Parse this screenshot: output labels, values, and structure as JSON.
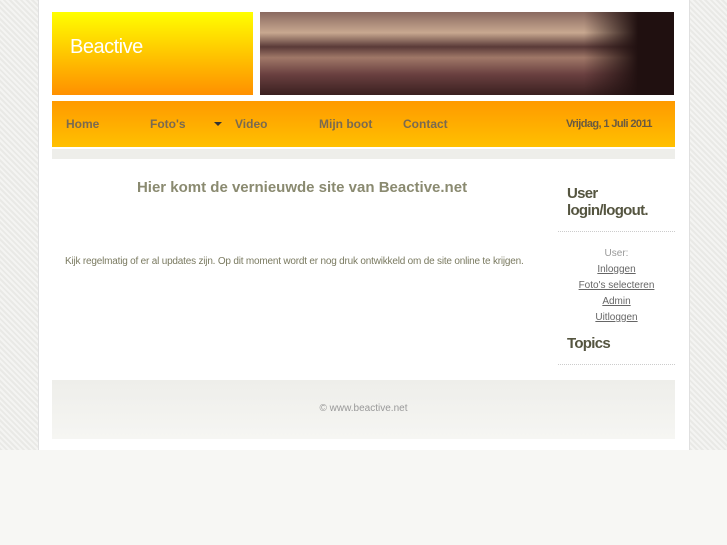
{
  "site": {
    "name": "Beactive"
  },
  "nav": {
    "items": [
      "Home",
      "Foto's",
      "Video",
      "Mijn boot",
      "Contact"
    ],
    "date": "Vrijdag, 1 Juli 2011"
  },
  "main": {
    "title": "Hier komt de vernieuwde site van Beactive.net",
    "text": "Kijk regelmatig of er al updates zijn. Op dit moment wordt er nog druk ontwikkeld om de site online te krijgen."
  },
  "sidebar": {
    "login_title": "User login/logout.",
    "user_label": "User:",
    "links": [
      "Inloggen",
      "Foto's selecteren",
      "Admin",
      "Uitloggen"
    ],
    "topics_title": "Topics"
  },
  "footer": {
    "text": "© www.beactive.net"
  }
}
